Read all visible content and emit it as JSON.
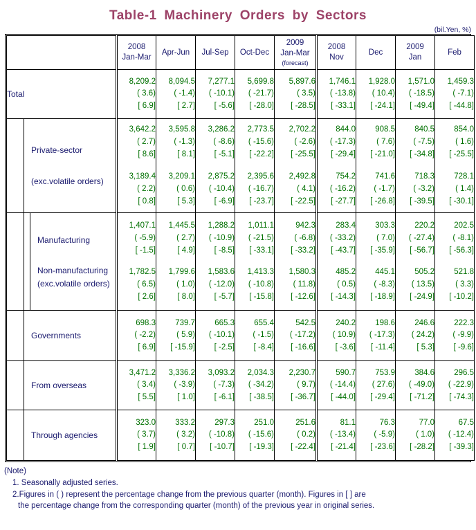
{
  "title": "Table-1  Machinery  Orders  by  Sectors",
  "unit_note": "(bil.Yen, %)",
  "header": {
    "label_col": "",
    "columns": [
      {
        "year": "2008",
        "period": "Jan-Mar",
        "note": ""
      },
      {
        "year": "",
        "period": "Apr-Jun",
        "note": ""
      },
      {
        "year": "",
        "period": "Jul-Sep",
        "note": ""
      },
      {
        "year": "",
        "period": "Oct-Dec",
        "note": ""
      },
      {
        "year": "2009",
        "period": "Jan-Mar",
        "note": "(forecast)"
      },
      {
        "year": "2008",
        "period": "Nov",
        "note": ""
      },
      {
        "year": "",
        "period": "Dec",
        "note": ""
      },
      {
        "year": "2009",
        "period": "Jan",
        "note": ""
      },
      {
        "year": "",
        "period": "Feb",
        "note": ""
      }
    ]
  },
  "rows": {
    "total": {
      "label": "Total",
      "cells": [
        {
          "v": "8,209.2",
          "q": "(  3.6)",
          "y": "[  6.9]"
        },
        {
          "v": "8,094.5",
          "q": "( -1.4)",
          "y": "[  2.7]"
        },
        {
          "v": "7,277.1",
          "q": "( -10.1)",
          "y": "[ -5.6]"
        },
        {
          "v": "5,699.8",
          "q": "( -21.7)",
          "y": "[ -28.0]"
        },
        {
          "v": "5,897.6",
          "q": "(  3.5)",
          "y": "[ -28.5]"
        },
        {
          "v": "1,746.1",
          "q": "( -13.8)",
          "y": "[ -33.1]"
        },
        {
          "v": "1,928.0",
          "q": "( 10.4)",
          "y": "[ -24.1]"
        },
        {
          "v": "1,571.0",
          "q": "( -18.5)",
          "y": "[ -49.4]"
        },
        {
          "v": "1,459.3",
          "q": "( -7.1)",
          "y": "[ -44.8]"
        }
      ]
    },
    "private": {
      "label": "Private-sector",
      "sublabel": "(exc.volatile orders)",
      "cells_a": [
        {
          "v": "3,642.2",
          "q": "(  2.7)",
          "y": "[  8.6]"
        },
        {
          "v": "3,595.8",
          "q": "( -1.3)",
          "y": "[  8.1]"
        },
        {
          "v": "3,286.2",
          "q": "( -8.6)",
          "y": "[ -5.1]"
        },
        {
          "v": "2,773.5",
          "q": "( -15.6)",
          "y": "[ -22.2]"
        },
        {
          "v": "2,702.2",
          "q": "( -2.6)",
          "y": "[ -25.5]"
        },
        {
          "v": "844.0",
          "q": "( -17.3)",
          "y": "[ -29.4]"
        },
        {
          "v": "908.5",
          "q": "(  7.6)",
          "y": "[ -21.0]"
        },
        {
          "v": "840.5",
          "q": "( -7.5)",
          "y": "[ -34.8]"
        },
        {
          "v": "854.0",
          "q": "(  1.6)",
          "y": "[ -25.5]"
        }
      ],
      "cells_b": [
        {
          "v": "3,189.4",
          "q": "(  2.2)",
          "y": "[  0.8]"
        },
        {
          "v": "3,209.1",
          "q": "(  0.6)",
          "y": "[  5.3]"
        },
        {
          "v": "2,875.2",
          "q": "( -10.4)",
          "y": "[ -6.9]"
        },
        {
          "v": "2,395.6",
          "q": "( -16.7)",
          "y": "[ -23.7]"
        },
        {
          "v": "2,492.8",
          "q": "(  4.1)",
          "y": "[ -22.5]"
        },
        {
          "v": "754.2",
          "q": "( -16.2)",
          "y": "[ -27.7]"
        },
        {
          "v": "741.6",
          "q": "( -1.7)",
          "y": "[ -26.8]"
        },
        {
          "v": "718.3",
          "q": "( -3.2)",
          "y": "[ -39.5]"
        },
        {
          "v": "728.1",
          "q": "(  1.4)",
          "y": "[ -30.1]"
        }
      ]
    },
    "manufacturing": {
      "label": "Manufacturing",
      "cells": [
        {
          "v": "1,407.1",
          "q": "( -5.9)",
          "y": "[ -1.5]"
        },
        {
          "v": "1,445.5",
          "q": "(  2.7)",
          "y": "[  4.9]"
        },
        {
          "v": "1,288.2",
          "q": "( -10.9)",
          "y": "[ -8.5]"
        },
        {
          "v": "1,011.1",
          "q": "( -21.5)",
          "y": "[ -33.1]"
        },
        {
          "v": "942.3",
          "q": "( -6.8)",
          "y": "[ -33.2]"
        },
        {
          "v": "283.4",
          "q": "( -33.2)",
          "y": "[ -43.7]"
        },
        {
          "v": "303.3",
          "q": "(  7.0)",
          "y": "[ -35.9]"
        },
        {
          "v": "220.2",
          "q": "( -27.4)",
          "y": "[ -56.7]"
        },
        {
          "v": "202.5",
          "q": "( -8.1)",
          "y": "[ -56.3]"
        }
      ]
    },
    "nonmanufacturing": {
      "label": "Non-manufacturing",
      "sublabel": "(exc.volatile orders)",
      "cells": [
        {
          "v": "1,782.5",
          "q": "(  6.5)",
          "y": "[  2.6]"
        },
        {
          "v": "1,799.6",
          "q": "(  1.0)",
          "y": "[  8.0]"
        },
        {
          "v": "1,583.6",
          "q": "( -12.0)",
          "y": "[ -5.7]"
        },
        {
          "v": "1,413.3",
          "q": "( -10.8)",
          "y": "[ -15.8]"
        },
        {
          "v": "1,580.3",
          "q": "( 11.8)",
          "y": "[ -12.6]"
        },
        {
          "v": "485.2",
          "q": "(  0.5)",
          "y": "[ -14.3]"
        },
        {
          "v": "445.1",
          "q": "( -8.3)",
          "y": "[ -18.9]"
        },
        {
          "v": "505.2",
          "q": "( 13.5)",
          "y": "[ -24.9]"
        },
        {
          "v": "521.8",
          "q": "(  3.3)",
          "y": "[ -10.2]"
        }
      ]
    },
    "governments": {
      "label": "Governments",
      "cells": [
        {
          "v": "698.3",
          "q": "( -2.2)",
          "y": "[  6.9]"
        },
        {
          "v": "739.7",
          "q": "(  5.9)",
          "y": "[ -15.9]"
        },
        {
          "v": "665.3",
          "q": "( -10.1)",
          "y": "[ -2.5]"
        },
        {
          "v": "655.4",
          "q": "( -1.5)",
          "y": "[ -8.4]"
        },
        {
          "v": "542.5",
          "q": "( -17.2)",
          "y": "[ -16.6]"
        },
        {
          "v": "240.2",
          "q": "( 10.9)",
          "y": "[ -3.6]"
        },
        {
          "v": "198.6",
          "q": "( -17.3)",
          "y": "[ -11.4]"
        },
        {
          "v": "246.6",
          "q": "( 24.2)",
          "y": "[  5.3]"
        },
        {
          "v": "222.3",
          "q": "( -9.9)",
          "y": "[ -9.6]"
        }
      ]
    },
    "overseas": {
      "label": "From overseas",
      "cells": [
        {
          "v": "3,471.2",
          "q": "(  3.4)",
          "y": "[  5.5]"
        },
        {
          "v": "3,336.2",
          "q": "( -3.9)",
          "y": "[  1.0]"
        },
        {
          "v": "3,093.2",
          "q": "( -7.3)",
          "y": "[ -6.1]"
        },
        {
          "v": "2,034.3",
          "q": "( -34.2)",
          "y": "[ -38.5]"
        },
        {
          "v": "2,230.7",
          "q": "(  9.7)",
          "y": "[ -36.7]"
        },
        {
          "v": "590.7",
          "q": "( -14.4)",
          "y": "[ -44.0]"
        },
        {
          "v": "753.9",
          "q": "( 27.6)",
          "y": "[ -29.4]"
        },
        {
          "v": "384.6",
          "q": "( -49.0)",
          "y": "[ -71.2]"
        },
        {
          "v": "296.5",
          "q": "( -22.9)",
          "y": "[ -74.3]"
        }
      ]
    },
    "agencies": {
      "label": "Through agencies",
      "cells": [
        {
          "v": "323.0",
          "q": "(  3.7)",
          "y": "[  1.9]"
        },
        {
          "v": "333.2",
          "q": "(  3.2)",
          "y": "[  0.7]"
        },
        {
          "v": "297.3",
          "q": "( -10.8)",
          "y": "[ -10.7]"
        },
        {
          "v": "251.0",
          "q": "( -15.6)",
          "y": "[ -19.3]"
        },
        {
          "v": "251.6",
          "q": "(  0.2)",
          "y": "[ -22.4]"
        },
        {
          "v": "81.1",
          "q": "( -13.4)",
          "y": "[ -21.4]"
        },
        {
          "v": "76.3",
          "q": "( -5.9)",
          "y": "[ -23.6]"
        },
        {
          "v": "77.0",
          "q": "(  1.0)",
          "y": "[ -28.2]"
        },
        {
          "v": "67.5",
          "q": "( -12.4)",
          "y": "[ -39.3]"
        }
      ]
    }
  },
  "notes": {
    "head": "(Note)",
    "item1": "1. Seasonally adjusted series.",
    "item2": "2.Figures in ( ) represent the percentage change from the previous quarter (month). Figures in [ ] are",
    "item2_cont": "the percentage change from the corresponding quarter (month) of the previous year in original series."
  },
  "colors": {
    "title": "#9d4368",
    "text": "#1a1a6e",
    "value": "#007000"
  }
}
